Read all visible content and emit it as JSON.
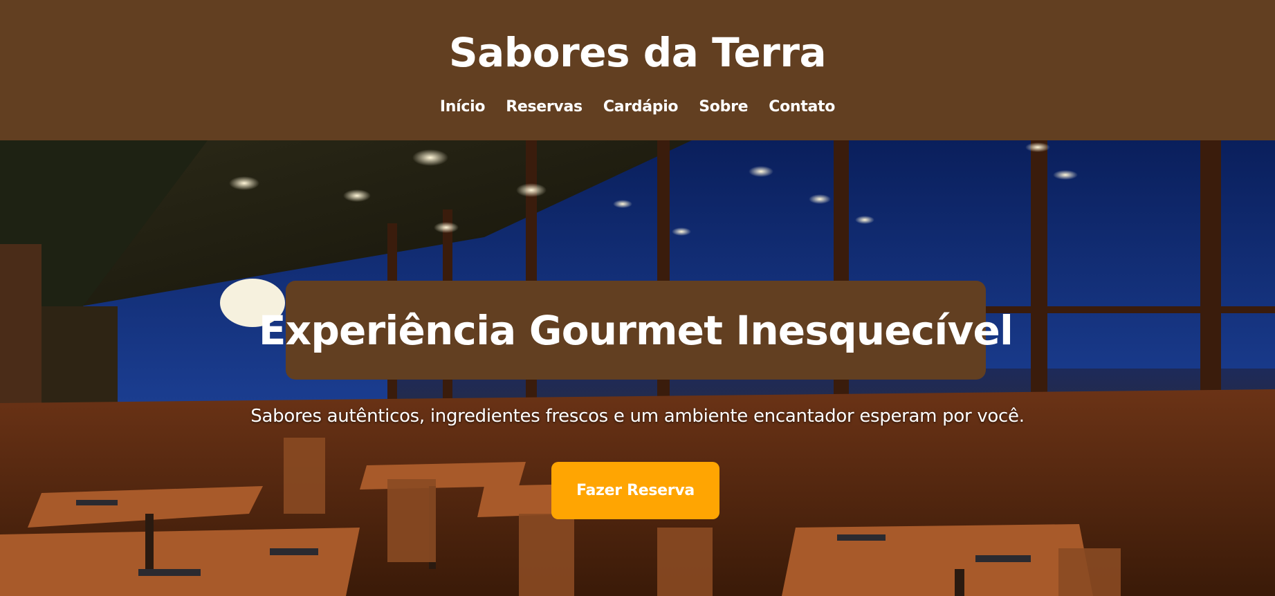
{
  "header": {
    "title": "Sabores da Terra",
    "nav": [
      {
        "label": "Início"
      },
      {
        "label": "Reservas"
      },
      {
        "label": "Cardápio"
      },
      {
        "label": "Sobre"
      },
      {
        "label": "Contato"
      }
    ]
  },
  "hero": {
    "title": "Experiência Gourmet Inesquecível",
    "subtitle": "Sabores autênticos, ingredientes frescos e um ambiente encantador esperam por você.",
    "cta_label": "Fazer Reserva"
  },
  "colors": {
    "brand_brown": "#623f21",
    "accent_orange": "#ffa502",
    "text_white": "#ffffff"
  }
}
